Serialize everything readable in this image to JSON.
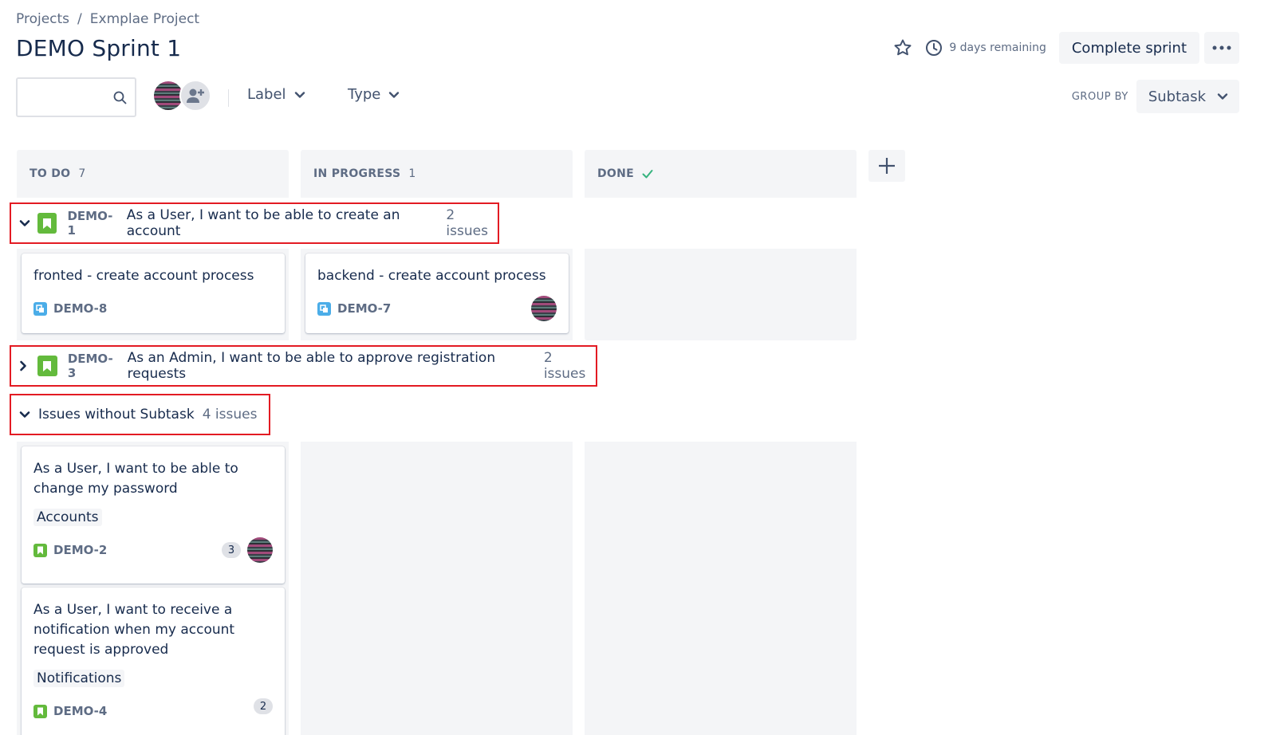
{
  "breadcrumb": {
    "root": "Projects",
    "separator": "/",
    "project": "Exmplae Project"
  },
  "page": {
    "title": "DEMO Sprint 1"
  },
  "header": {
    "days_remaining": "9 days remaining",
    "complete_label": "Complete sprint"
  },
  "toolbar": {
    "search_placeholder": "",
    "filter_label": "Label",
    "filter_type": "Type",
    "group_by_label": "GROUP BY",
    "group_by_value": "Subtask"
  },
  "columns": [
    {
      "name": "TO DO",
      "count": "7"
    },
    {
      "name": "IN PROGRESS",
      "count": "1"
    },
    {
      "name": "DONE",
      "count": ""
    }
  ],
  "swimlanes": [
    {
      "key": "DEMO-1",
      "title": "As a User, I want to be able to create an account",
      "count": "2 issues"
    },
    {
      "key": "DEMO-3",
      "title": "As an Admin, I want to be able to approve registration requests",
      "count": "2 issues"
    },
    {
      "title": "Issues without Subtask",
      "count": "4 issues"
    }
  ],
  "cards": {
    "demo8": {
      "summary": "fronted - create account process",
      "key": "DEMO-8"
    },
    "demo7": {
      "summary": "backend - create account process",
      "key": "DEMO-7"
    },
    "demo2": {
      "summary": "As a User, I want to be able to change my password",
      "label": "Accounts",
      "key": "DEMO-2",
      "subtasks": "3"
    },
    "demo4": {
      "summary": "As a User, I want to receive a notification when my account request is approved",
      "label": "Notifications",
      "key": "DEMO-4",
      "subtasks": "2"
    }
  },
  "colors": {
    "story": "#63ba3c",
    "subtask": "#4bade8",
    "highlight": "#e31b23",
    "column_bg": "#f4f5f7"
  }
}
